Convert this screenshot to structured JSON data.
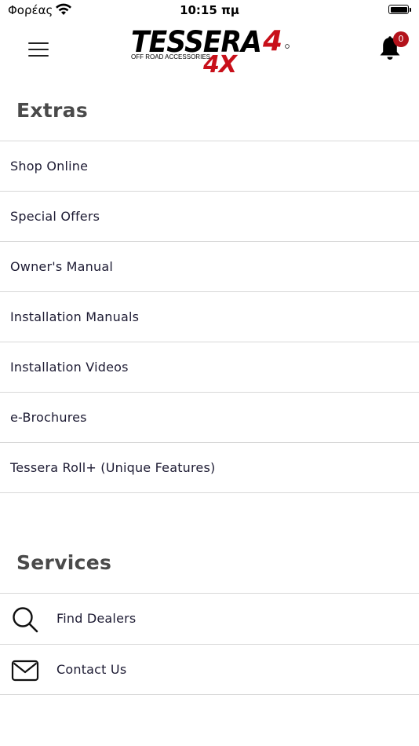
{
  "status_bar": {
    "carrier": "Φορέας",
    "time": "10:15 πμ"
  },
  "header": {
    "logo_text": "TESSERA",
    "logo_number": "4",
    "logo_suffix": "4X",
    "logo_tagline": "OFF ROAD ACCESSORIES",
    "notification_count": "0"
  },
  "extras": {
    "title": "Extras",
    "items": [
      {
        "label": "Shop Online"
      },
      {
        "label": "Special Offers"
      },
      {
        "label": "Owner's Manual"
      },
      {
        "label": "Installation Manuals"
      },
      {
        "label": "Installation Videos"
      },
      {
        "label": "e-Brochures"
      },
      {
        "label": "Tessera Roll+ (Unique Features)"
      }
    ]
  },
  "services": {
    "title": "Services",
    "items": [
      {
        "label": "Find Dealers",
        "icon": "search-icon"
      },
      {
        "label": "Contact Us",
        "icon": "mail-icon"
      }
    ]
  },
  "colors": {
    "accent": "#b3121b",
    "text": "#1d1b33",
    "title": "#4a4a4a",
    "divider": "#d8d8d8"
  }
}
